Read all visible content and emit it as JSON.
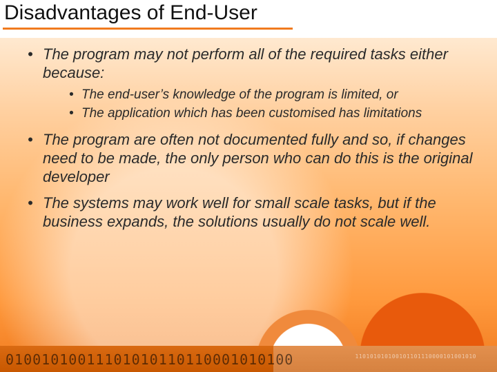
{
  "title": "Disadvantages of End-User",
  "bullets": [
    {
      "text": "The program may not perform all of the required tasks either because:",
      "sub": [
        "The end-user’s knowledge of the program is limited, or",
        "The application which has been customised has limitations"
      ]
    },
    {
      "text": "The program are often not documented fully and so, if changes need to be made, the only person who can do this is the original developer"
    },
    {
      "text": "The systems may work well for small scale tasks, but if the business expands, the solutions usually do not scale well."
    }
  ],
  "deco": {
    "binary_large": "01001010011101010110110001010100",
    "binary_small": "110101010100101101110000101001010"
  }
}
